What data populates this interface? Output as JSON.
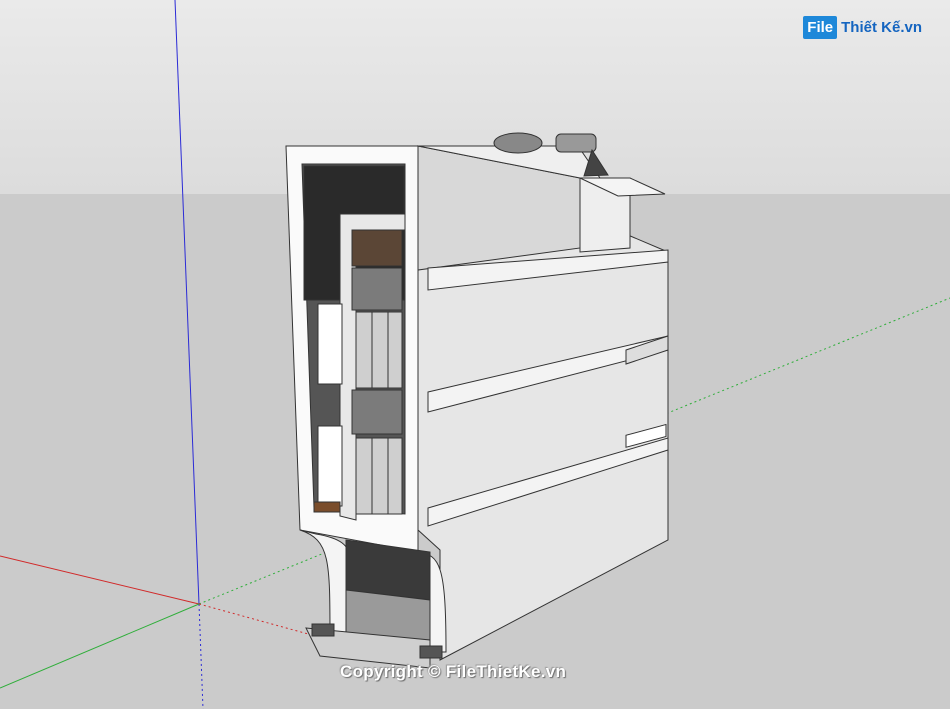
{
  "watermark": {
    "logo_box": "File",
    "logo_text": "Thiết Kế.vn",
    "copyright": "Copyright © FileThietKe.vn"
  },
  "colors": {
    "sky": "#e2e2e2",
    "ground": "#cbcbcb",
    "axis_blue": "#2b2bd6",
    "axis_red": "#d12a2a",
    "axis_green": "#2fae3a",
    "logo_blue": "#1e88d9"
  }
}
